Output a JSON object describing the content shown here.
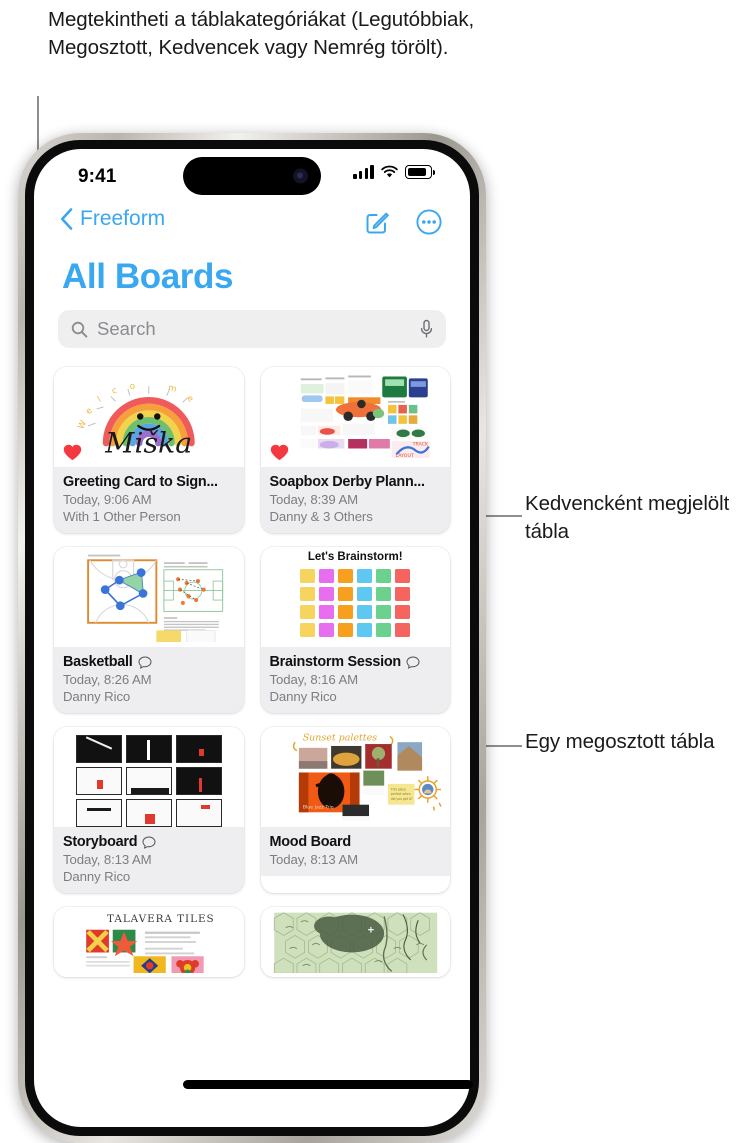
{
  "callouts": {
    "top": "Megtekintheti a táblakategóriákat (Legutóbbiak, Megosztott, Kedvencek vagy Nemrég törölt).",
    "favorite": "Kedvencként megjelölt tábla",
    "shared": "Egy megosztott tábla"
  },
  "status_bar": {
    "time": "9:41",
    "cellular_icon": "signal-bars-icon",
    "wifi_icon": "wifi-icon",
    "battery_icon": "battery-icon"
  },
  "nav": {
    "back_label": "Freeform",
    "back_icon": "chevron-left-icon",
    "compose_icon": "compose-icon",
    "more_icon": "more-circle-icon"
  },
  "page": {
    "title": "All Boards"
  },
  "search": {
    "placeholder": "Search",
    "search_icon": "search-icon",
    "mic_icon": "microphone-icon"
  },
  "colors": {
    "accent": "#39a8f0",
    "favorite": "#f3393f",
    "card_meta_bg": "#eeeef0",
    "search_bg": "#efeff0"
  },
  "boards": [
    {
      "title": "Greeting Card to Sign...",
      "date": "Today, 9:06 AM",
      "people": "With 1 Other Person",
      "favorite": true,
      "shared_icon": false,
      "thumb": "greeting-card-rainbow",
      "thumb_text": "Miška"
    },
    {
      "title": "Soapbox Derby Plann...",
      "date": "Today, 8:39 AM",
      "people": "Danny & 3 Others",
      "favorite": true,
      "shared_icon": false,
      "thumb": "soapbox-derby-collage"
    },
    {
      "title": "Basketball",
      "date": "Today, 8:26 AM",
      "people": "Danny Rico",
      "favorite": false,
      "shared_icon": true,
      "thumb": "basketball-court-diagram"
    },
    {
      "title": "Brainstorm Session",
      "date": "Today, 8:16 AM",
      "people": "Danny Rico",
      "favorite": false,
      "shared_icon": true,
      "thumb": "brainstorm-sticky-notes",
      "thumb_text": "Let's Brainstorm!"
    },
    {
      "title": "Storyboard",
      "date": "Today, 8:13 AM",
      "people": "Danny Rico",
      "favorite": false,
      "shared_icon": true,
      "thumb": "storyboard-ink-panels"
    },
    {
      "title": "Mood Board",
      "date": "Today, 8:13 AM",
      "people": "",
      "favorite": false,
      "shared_icon": false,
      "thumb": "mood-board-photos",
      "thumb_text": "Sunset palettes"
    },
    {
      "title": "",
      "date": "",
      "people": "",
      "favorite": false,
      "shared_icon": false,
      "thumb": "talavera-tiles",
      "thumb_text": "TALAVERA TILES"
    },
    {
      "title": "",
      "date": "",
      "people": "",
      "favorite": false,
      "shared_icon": false,
      "thumb": "hex-map"
    }
  ]
}
